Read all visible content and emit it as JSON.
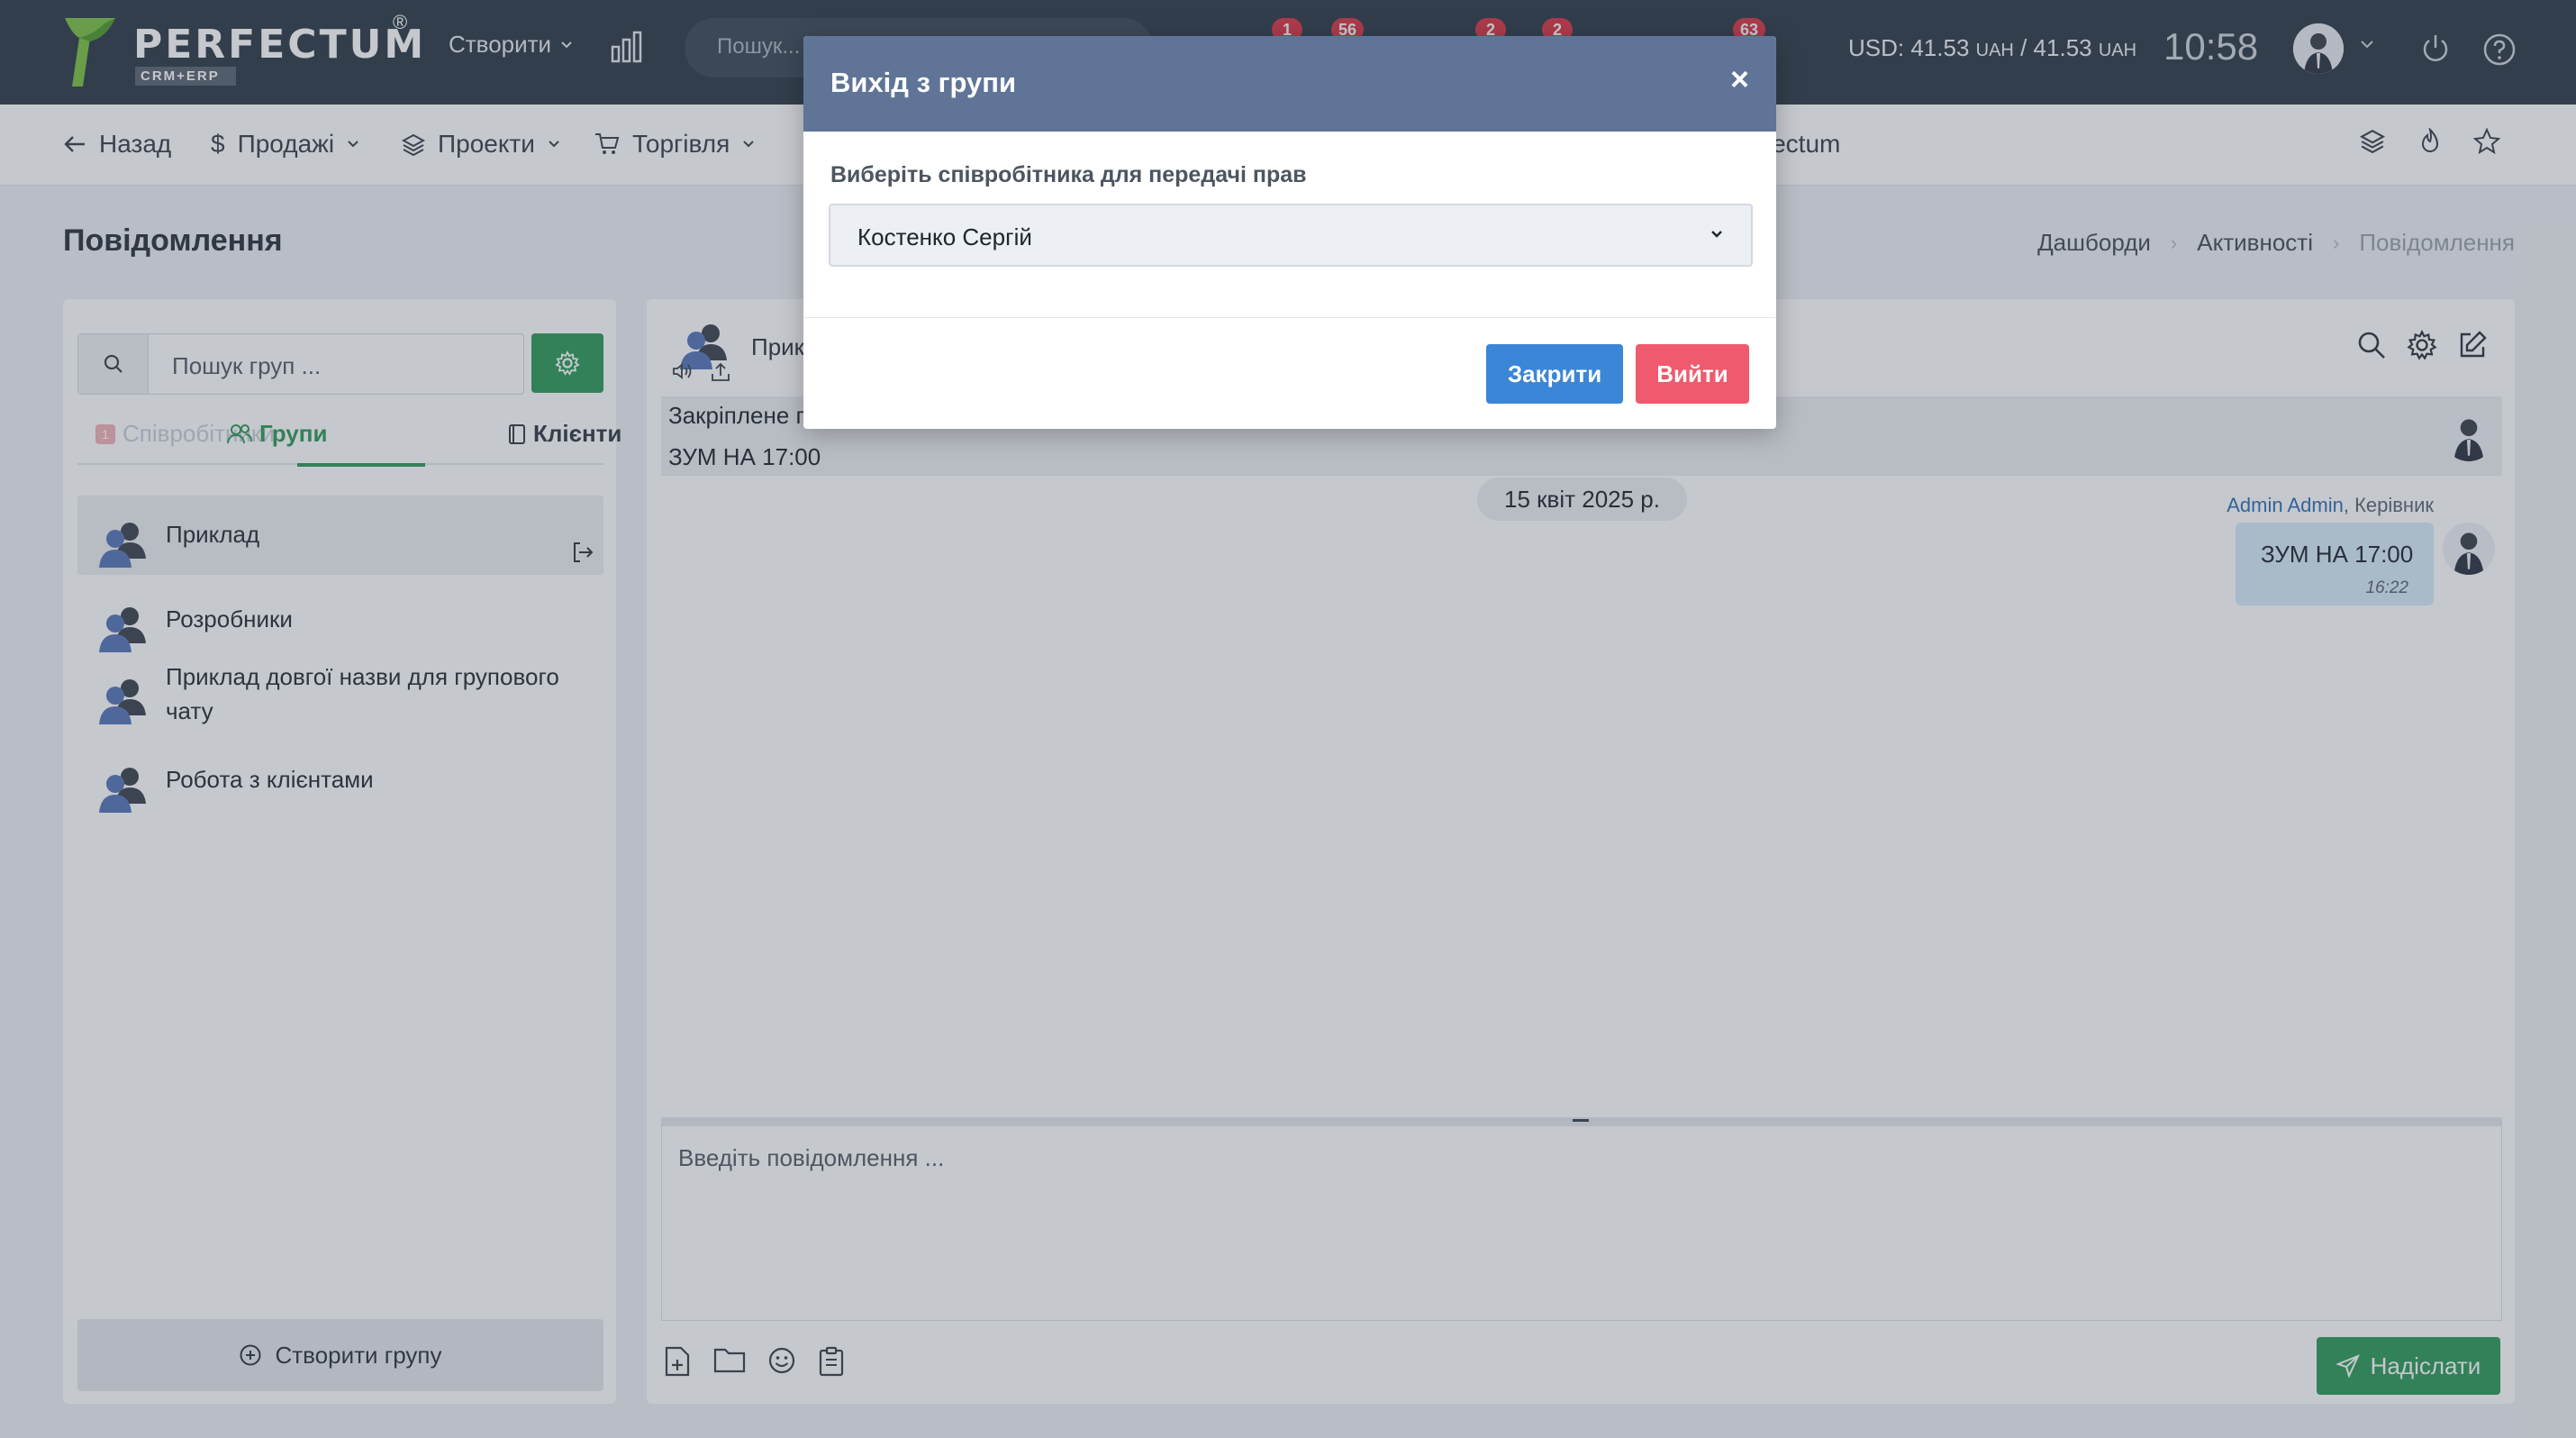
{
  "topbar": {
    "brand": "PERFECTUM",
    "brand_mark": "®",
    "brand_sub": "CRM+ERP",
    "create_label": "Створити",
    "search_placeholder": "Пошук...",
    "badges": [
      "1",
      "56",
      "2",
      "2",
      "63"
    ],
    "currency": {
      "prefix": "USD: 41.53 ",
      "unit1": "UAH",
      "mid": " / 41.53 ",
      "unit2": "UAH"
    },
    "clock": "10:58",
    "icons": [
      "chart-bars-icon",
      "chevron-down-icon",
      "power-icon",
      "help-icon"
    ]
  },
  "nav": {
    "back": "Назад",
    "sales": "Продажі",
    "projects": "Проекти",
    "trade": "Торгівля",
    "partial": "rfectum"
  },
  "page": {
    "title": "Повідомлення",
    "breadcrumb": [
      "Дашборди",
      "Активності",
      "Повідомлення"
    ]
  },
  "left": {
    "search_placeholder": "Пошук груп ...",
    "tabs": {
      "employees": "Співробітники",
      "employees_badge": "1",
      "groups": "Групи",
      "clients": "Клієнти"
    },
    "groups": [
      {
        "name": "Приклад"
      },
      {
        "name": "Розробники"
      },
      {
        "name": "Приклад довгої назви для групового чату"
      },
      {
        "name": "Робота з клієнтами"
      }
    ],
    "create_group": "Створити групу"
  },
  "chat": {
    "title": "Прик",
    "pinned_label": "Закріплене п",
    "pinned_text": "ЗУМ НА 17:00",
    "date": "15 квіт 2025 р.",
    "message": {
      "author": "Admin Admin",
      "role": ", Керівник",
      "text": "ЗУМ НА 17:00",
      "time": "16:22"
    },
    "input_placeholder": "Введіть повідомлення ...",
    "send": "Надіслати"
  },
  "modal": {
    "title": "Вихід з групи",
    "close_x": "×",
    "label": "Виберіть співробітника для передачі прав",
    "selected": "Костенко Сергій",
    "btn_close": "Закрити",
    "btn_leave": "Вийти"
  },
  "colors": {
    "topbar": "#2d3a47",
    "accent_green": "#2e9a58",
    "modal_header": "#5f7497",
    "btn_primary": "#3b86d6",
    "btn_danger": "#ef5a6e",
    "badge": "#dc3545"
  }
}
